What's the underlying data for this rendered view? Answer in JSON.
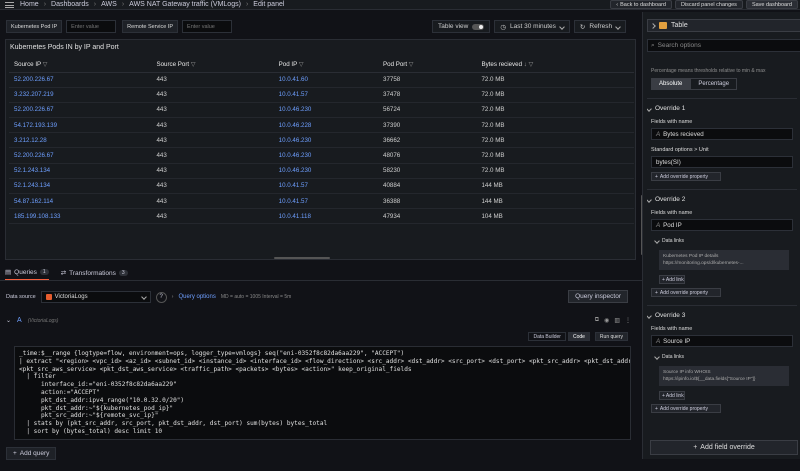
{
  "breadcrumbs": [
    "Home",
    "Dashboards",
    "AWS",
    "AWS NAT Gateway traffic (VMLogs)",
    "Edit panel"
  ],
  "top_actions": {
    "back": "Back to dashboard",
    "discard": "Discard panel changes",
    "save": "Save dashboard"
  },
  "variables": [
    {
      "label": "Kubernetes Pod IP",
      "placeholder": "Enter value"
    },
    {
      "label": "Remote Service IP",
      "placeholder": "Enter value"
    }
  ],
  "controls": {
    "table_view": "Table view",
    "time_range": "Last 30 minutes",
    "refresh": "Refresh"
  },
  "panel": {
    "title": "Kubernetes Pods IN by IP and Port",
    "columns": [
      "Source IP",
      "Source Port",
      "Pod IP",
      "Pod Port",
      "Bytes recieved"
    ],
    "rows": [
      [
        "52.200.226.67",
        "443",
        "10.0.41.60",
        "37758",
        "72.0 MB"
      ],
      [
        "3.232.207.219",
        "443",
        "10.0.41.57",
        "37478",
        "72.0 MB"
      ],
      [
        "52.200.226.67",
        "443",
        "10.0.46.230",
        "56724",
        "72.0 MB"
      ],
      [
        "54.172.193.139",
        "443",
        "10.0.46.228",
        "37390",
        "72.0 MB"
      ],
      [
        "3.212.12.28",
        "443",
        "10.0.46.230",
        "36662",
        "72.0 MB"
      ],
      [
        "52.200.226.67",
        "443",
        "10.0.46.230",
        "48076",
        "72.0 MB"
      ],
      [
        "52.1.243.134",
        "443",
        "10.0.46.230",
        "58230",
        "72.0 MB"
      ],
      [
        "52.1.243.134",
        "443",
        "10.0.41.57",
        "40884",
        "144 MB"
      ],
      [
        "54.87.162.114",
        "443",
        "10.0.41.57",
        "36388",
        "144 MB"
      ],
      [
        "185.199.108.133",
        "443",
        "10.0.41.118",
        "47934",
        "104 MB"
      ]
    ]
  },
  "tabs": [
    {
      "label": "Queries",
      "count": "1"
    },
    {
      "label": "Transformations",
      "count": "3"
    }
  ],
  "query": {
    "ds_label": "Data source",
    "ds_value": "VictoriaLogs",
    "options": "Query options",
    "meta": "MD = auto = 1005     Interval = 5m",
    "inspector": "Query inspector",
    "letter": "A",
    "ds_sub": "(VictoriaLogs)",
    "modes": [
      "Data Builder",
      "Code",
      "Run query"
    ],
    "code": "_time:$__range {logtype=flow, environment=ops, logger_type=vmlogs} seq(\"eni-0352f8c82da6aa229\", \"ACCEPT\")\n| extract \"<region> <vpc_id> <az_id> <subnet_id> <instance_id> <interface_id> <flow_direction> <src_addr> <dst_addr> <src_port> <dst_port> <pkt_src_addr> <pkt_dst_addr>\n<pkt_src_aws_service> <pkt_dst_aws_service> <traffic_path> <packets> <bytes> <action>\" keep_original_fields\n  | filter\n      interface_id:=\"eni-0352f8c82da6aa229\"\n      action:=\"ACCEPT\"\n      pkt_dst_addr:ipv4_range(\"10.0.32.0/20\")\n      pkt_dst_addr:~\"${kubernetes_pod_ip}\"\n      pkt_src_addr:~\"${remote_svc_ip}\"\n  | stats by (pkt_src_addr, src_port, pkt_dst_addr, dst_port) sum(bytes) bytes_total\n  | sort by (bytes_total) desc limit 10",
    "add": "Add query"
  },
  "options": {
    "viz": "Table",
    "search": "Search options",
    "helptext": "Percentage means thresholds relative to min & max",
    "threshold_modes": [
      "Absolute",
      "Percentage"
    ],
    "override1": {
      "title": "Override 1",
      "fields_label": "Fields with name",
      "field": "Bytes recieved",
      "std_label": "Standard options > Unit",
      "unit": "bytes(SI)",
      "add_prop": "Add override property"
    },
    "override2": {
      "title": "Override 2",
      "fields_label": "Fields with name",
      "field": "Pod IP",
      "dl_label": "Data links",
      "dl_title": "Kubernetes Pod IP details",
      "dl_url": "https://monitoring.ops/d/kubernetes-...",
      "add_link": "Add link",
      "add_prop": "Add override property"
    },
    "override3": {
      "title": "Override 3",
      "fields_label": "Fields with name",
      "field": "Source IP",
      "dl_label": "Data links",
      "dl_title": "Source IP info WHOIS",
      "dl_url": "https://ipinfo.io/${__data.fields[\"Source IP\"]}",
      "add_link": "Add link",
      "add_prop": "Add override property"
    },
    "add_field_override": "Add field override"
  }
}
